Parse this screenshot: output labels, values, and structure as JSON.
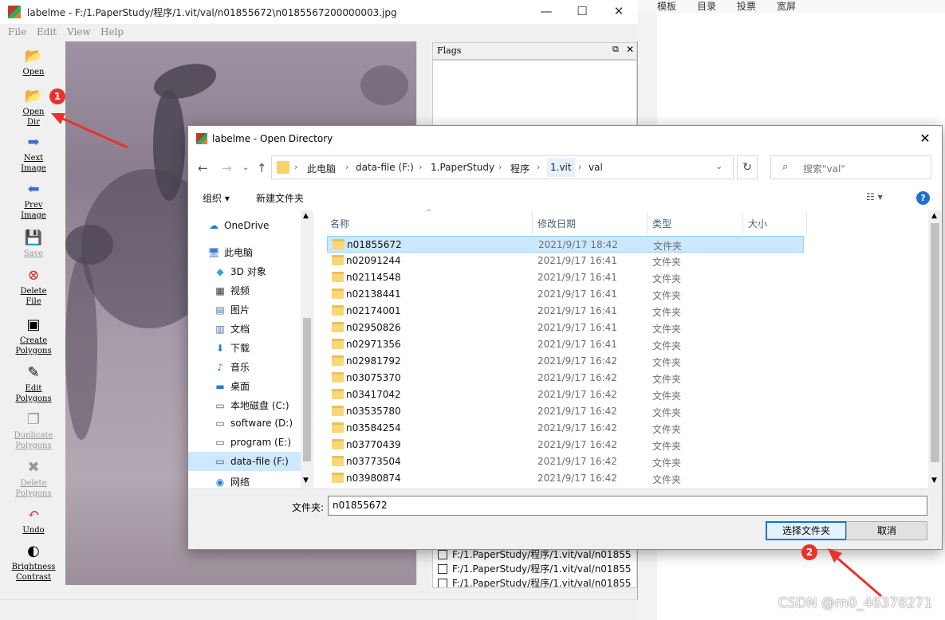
{
  "background_app": {
    "menu": [
      "模板",
      "目录",
      "投票",
      "宽屏"
    ],
    "watermark": "CSDN @m0_46378271"
  },
  "main_window": {
    "title": "labelme - F:/1.PaperStudy/程序/1.vit/val/n01855672\\n0185567200000003.jpg",
    "menu": [
      "File",
      "Edit",
      "View",
      "Help"
    ],
    "tools": [
      {
        "label": "Open",
        "icon": "folder-open-icon",
        "enabled": true
      },
      {
        "label": "Open\nDir",
        "icon": "folder-open-icon",
        "enabled": true
      },
      {
        "label": "Next\nImage",
        "icon": "arrow-right-icon",
        "enabled": true
      },
      {
        "label": "Prev\nImage",
        "icon": "arrow-left-icon",
        "enabled": true
      },
      {
        "label": "Save",
        "icon": "save-icon",
        "enabled": false
      },
      {
        "label": "Delete\nFile",
        "icon": "delete-icon",
        "enabled": true
      },
      {
        "label": "Create\nPolygons",
        "icon": "create-polygon-icon",
        "enabled": true
      },
      {
        "label": "Edit\nPolygons",
        "icon": "edit-icon",
        "enabled": true
      },
      {
        "label": "Duplicate\nPolygons",
        "icon": "duplicate-icon",
        "enabled": false
      },
      {
        "label": "Delete\nPolygons",
        "icon": "delete-polygon-icon",
        "enabled": false
      },
      {
        "label": "Undo",
        "icon": "undo-icon",
        "enabled": true
      },
      {
        "label": "Brightness\nContrast",
        "icon": "brightness-icon",
        "enabled": true
      }
    ],
    "flags_title": "Flags",
    "file_list": [
      "F:/1.PaperStudy/程序/1.vit/val/n01855",
      "F:/1.PaperStudy/程序/1.vit/val/n01855",
      "F:/1.PaperStudy/程序/1.vit/val/n01855"
    ]
  },
  "dialog": {
    "title": "labelme - Open Directory",
    "breadcrumbs": [
      "此电脑",
      "data-file (F:)",
      "1.PaperStudy",
      "程序",
      "1.vit",
      "val"
    ],
    "search_placeholder": "搜索\"val\"",
    "commands": {
      "organize": "组织 ▾",
      "new_folder": "新建文件夹"
    },
    "nav_items": [
      {
        "label": "OneDrive",
        "icon": "cloud-icon",
        "color": "#1e7fd6"
      },
      {
        "label": "此电脑",
        "icon": "computer-icon",
        "color": "#3a7bd5"
      },
      {
        "label": "3D 对象",
        "icon": "cube-icon",
        "color": "#3aa0d8"
      },
      {
        "label": "视频",
        "icon": "video-icon",
        "color": "#333"
      },
      {
        "label": "图片",
        "icon": "pictures-icon",
        "color": "#4a6fa5"
      },
      {
        "label": "文档",
        "icon": "documents-icon",
        "color": "#4a6fa5"
      },
      {
        "label": "下载",
        "icon": "download-icon",
        "color": "#1e7fd6"
      },
      {
        "label": "音乐",
        "icon": "music-icon",
        "color": "#1e7fd6"
      },
      {
        "label": "桌面",
        "icon": "desktop-icon",
        "color": "#1e7fd6"
      },
      {
        "label": "本地磁盘 (C:)",
        "icon": "drive-icon",
        "color": "#555"
      },
      {
        "label": "software (D:)",
        "icon": "drive-icon",
        "color": "#555"
      },
      {
        "label": "program (E:)",
        "icon": "drive-icon",
        "color": "#555"
      },
      {
        "label": "data-file (F:)",
        "icon": "drive-icon",
        "color": "#555"
      },
      {
        "label": "网络",
        "icon": "network-icon",
        "color": "#1e7fd6"
      }
    ],
    "nav_selected": 12,
    "columns": {
      "name": "名称",
      "date": "修改日期",
      "type": "类型",
      "size": "大小"
    },
    "folders": [
      {
        "name": "n01855672",
        "date": "2021/9/17 18:42",
        "type": "文件夹"
      },
      {
        "name": "n02091244",
        "date": "2021/9/17 16:41",
        "type": "文件夹"
      },
      {
        "name": "n02114548",
        "date": "2021/9/17 16:41",
        "type": "文件夹"
      },
      {
        "name": "n02138441",
        "date": "2021/9/17 16:41",
        "type": "文件夹"
      },
      {
        "name": "n02174001",
        "date": "2021/9/17 16:41",
        "type": "文件夹"
      },
      {
        "name": "n02950826",
        "date": "2021/9/17 16:41",
        "type": "文件夹"
      },
      {
        "name": "n02971356",
        "date": "2021/9/17 16:41",
        "type": "文件夹"
      },
      {
        "name": "n02981792",
        "date": "2021/9/17 16:42",
        "type": "文件夹"
      },
      {
        "name": "n03075370",
        "date": "2021/9/17 16:42",
        "type": "文件夹"
      },
      {
        "name": "n03417042",
        "date": "2021/9/17 16:42",
        "type": "文件夹"
      },
      {
        "name": "n03535780",
        "date": "2021/9/17 16:42",
        "type": "文件夹"
      },
      {
        "name": "n03584254",
        "date": "2021/9/17 16:42",
        "type": "文件夹"
      },
      {
        "name": "n03770439",
        "date": "2021/9/17 16:42",
        "type": "文件夹"
      },
      {
        "name": "n03773504",
        "date": "2021/9/17 16:42",
        "type": "文件夹"
      },
      {
        "name": "n03980874",
        "date": "2021/9/17 16:42",
        "type": "文件夹"
      }
    ],
    "selected_folder": 0,
    "folder_label": "文件夹:",
    "folder_value": "n01855672",
    "select_button": "选择文件夹",
    "cancel_button": "取消"
  },
  "annotations": {
    "badge1": "1",
    "badge2": "2",
    "color": "#e8322d"
  }
}
